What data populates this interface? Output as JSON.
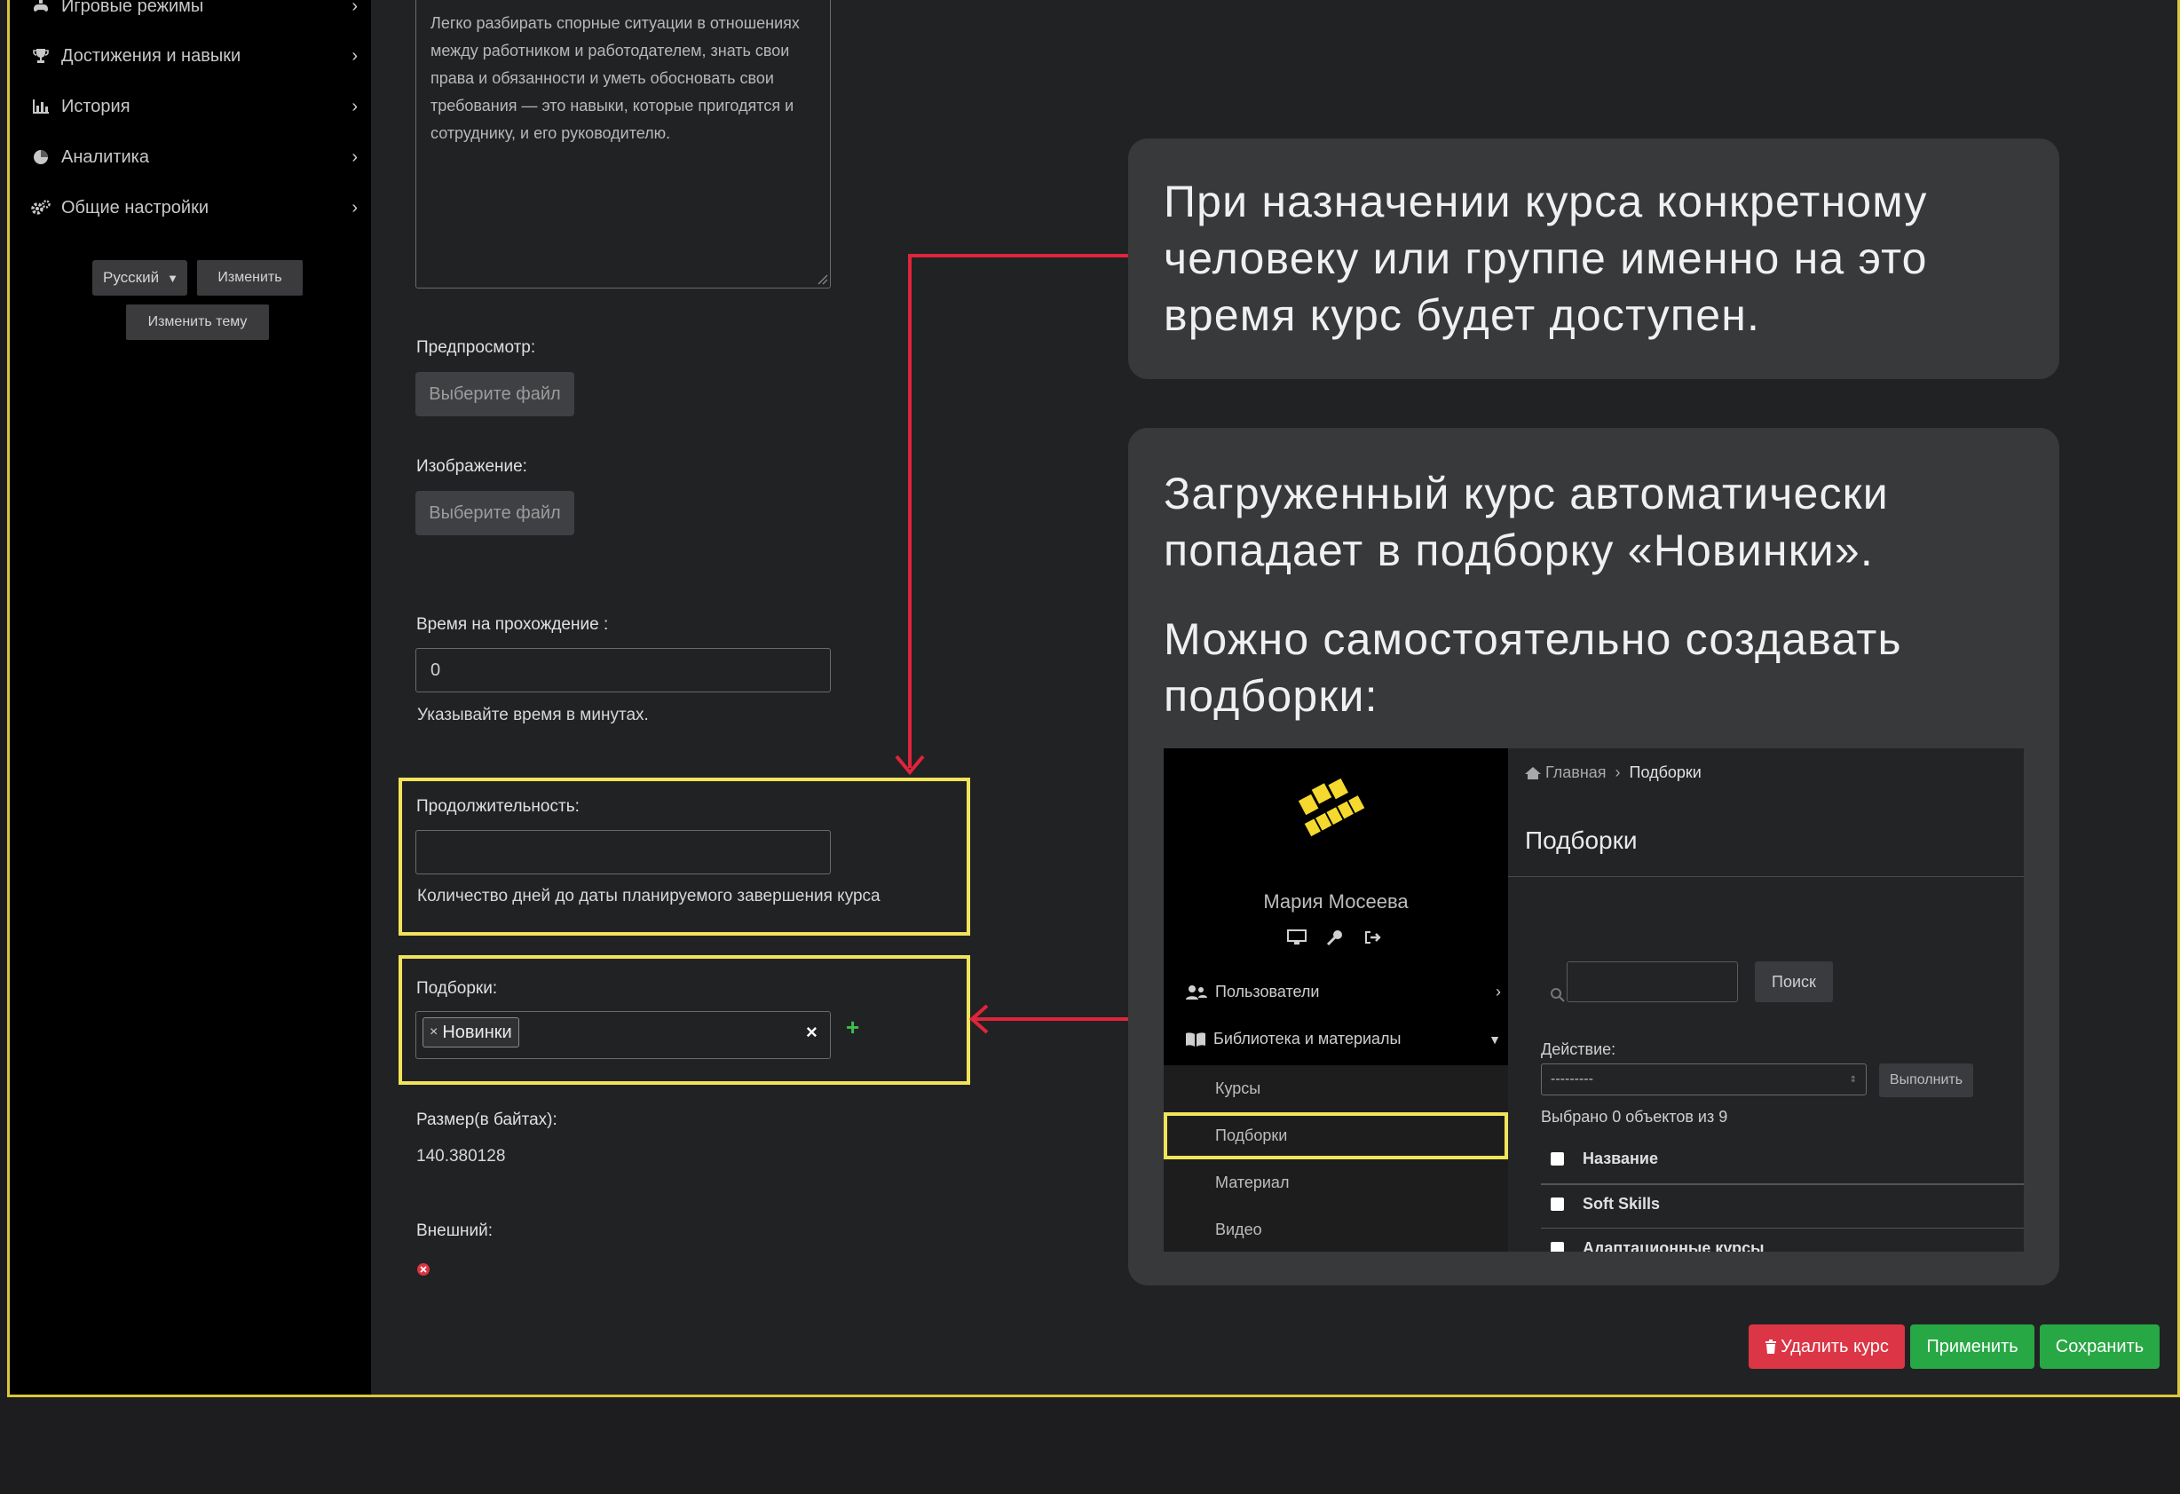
{
  "sidebar": {
    "items": [
      {
        "label": "Игровые режимы",
        "icon": "gamepad-icon"
      },
      {
        "label": "Достижения и навыки",
        "icon": "trophy-icon"
      },
      {
        "label": "История",
        "icon": "chart-icon"
      },
      {
        "label": "Аналитика",
        "icon": "pie-chart-icon"
      },
      {
        "label": "Общие настройки",
        "icon": "gears-icon"
      }
    ],
    "language_value": "Русский",
    "change_label": "Изменить",
    "change_theme_label": "Изменить тему"
  },
  "form": {
    "description_text": "Легко разбирать спорные ситуации в отношениях между работником и работодателем, знать свои права и обязанности и уметь обосновать свои требования — это навыки, которые пригодятся и сотруднику, и его руководителю.",
    "preview_label": "Предпросмотр:",
    "preview_button": "Выберите файл",
    "image_label": "Изображение:",
    "image_button": "Выберите файл",
    "time_label": "Время на прохождение :",
    "time_value": "0",
    "time_hint": "Указывайте время в минутах.",
    "duration_label": "Продолжительность:",
    "duration_value": "",
    "duration_hint": "Количество дней до даты планируемого завершения курса",
    "collections_label": "Подборки:",
    "collections_tag": "Новинки",
    "collections_clear": "×",
    "collections_add": "+",
    "size_label": "Размер(в байтах):",
    "size_value": "140.380128",
    "external_label": "Внешний:"
  },
  "callouts": {
    "top_text": "При назначении курса конкретному человеку или группе именно на это время курс будет доступен.",
    "bottom_text_1": "Загруженный курс автоматически попадает в подборку «Новинки».",
    "bottom_text_2": "Можно самостоятельно создавать подборки:"
  },
  "screenshot": {
    "user_name": "Мария Мосеева",
    "menu_users": "Пользователи",
    "menu_library": "Библиотека и материалы",
    "sub_courses": "Курсы",
    "sub_collections": "Подборки",
    "sub_material": "Материал",
    "sub_video": "Видео",
    "breadcrumb_home": "Главная",
    "breadcrumb_sep": "›",
    "breadcrumb_current": "Подборки",
    "page_title": "Подборки",
    "search_button": "Поиск",
    "action_label": "Действие:",
    "action_value": "---------",
    "execute_button": "Выполнить",
    "selected_text": "Выбрано 0 объектов из 9",
    "col_name": "Название",
    "rows": [
      "Soft Skills",
      "Адаптационные курсы"
    ]
  },
  "actions": {
    "delete_label": "Удалить курс",
    "apply_label": "Применить",
    "save_label": "Сохранить"
  },
  "colors": {
    "delete": "#dc3545",
    "apply": "#28a745",
    "highlight": "#f1e45a",
    "arrow": "#e0243b"
  }
}
